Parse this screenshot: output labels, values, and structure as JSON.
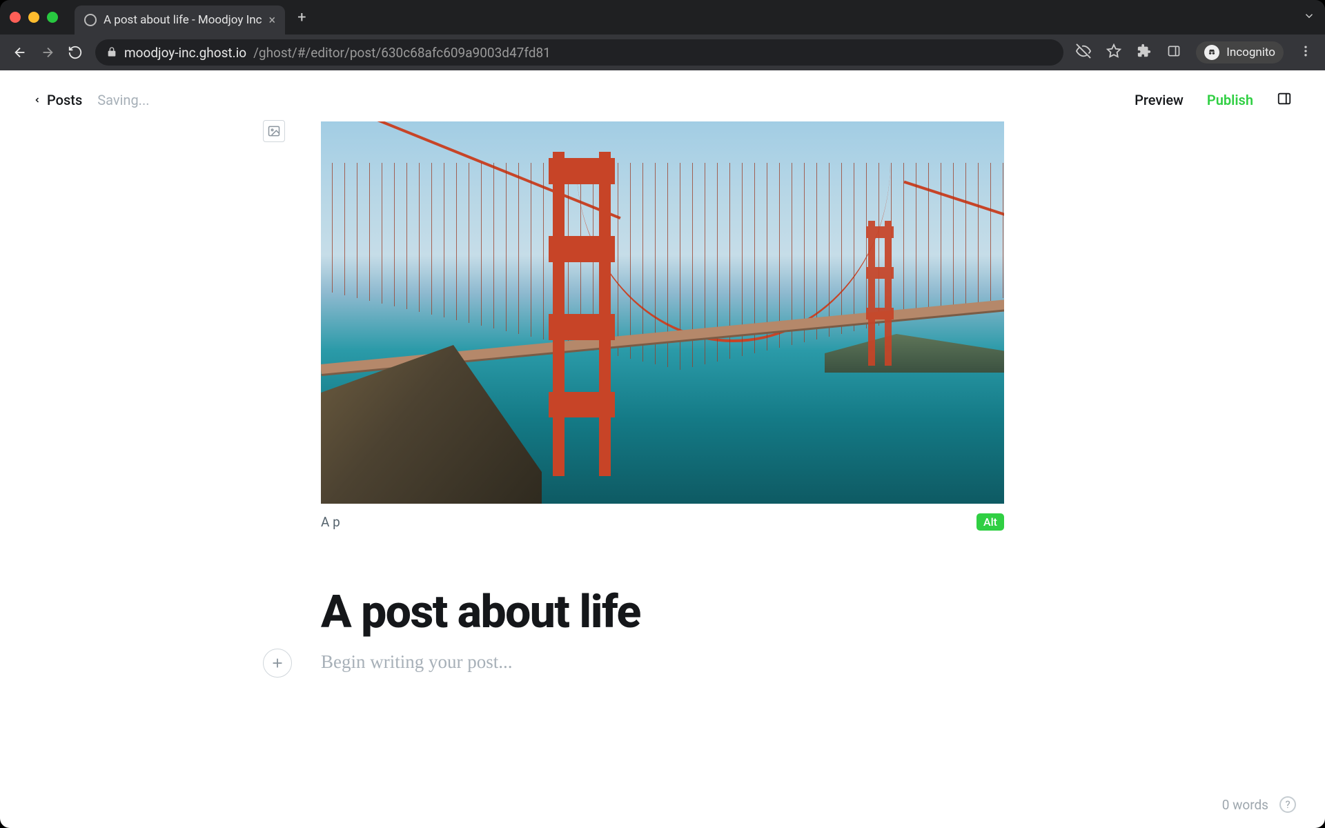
{
  "browser": {
    "tab_title": "A post about life - Moodjoy Inc",
    "url_host": "moodjoy-inc.ghost.io",
    "url_path": "/ghost/#/editor/post/630c68afc609a9003d47fd81",
    "incognito_label": "Incognito"
  },
  "header": {
    "back_label": "Posts",
    "status": "Saving...",
    "preview_label": "Preview",
    "publish_label": "Publish"
  },
  "editor": {
    "caption_value": "A p",
    "alt_label": "Alt",
    "title": "A post about life",
    "body_placeholder": "Begin writing your post..."
  },
  "footer": {
    "word_count": "0 words"
  }
}
